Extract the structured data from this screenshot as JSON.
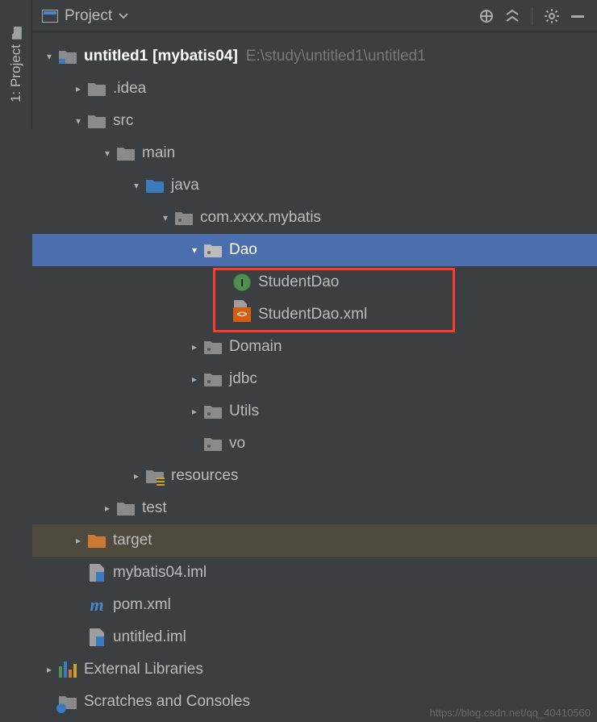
{
  "sidebar_tab": {
    "label": "1: Project"
  },
  "toolbar": {
    "title": "Project"
  },
  "tree": {
    "root": {
      "name": "untitled1",
      "module": "[mybatis04]",
      "path": "E:\\study\\untitled1\\untitled1"
    },
    "idea": ".idea",
    "src": "src",
    "main": "main",
    "java": "java",
    "pkg": "com.xxxx.mybatis",
    "dao": "Dao",
    "student_dao": "StudentDao",
    "student_dao_xml": "StudentDao.xml",
    "domain": "Domain",
    "jdbc": "jdbc",
    "utils": "Utils",
    "vo": "vo",
    "resources": "resources",
    "test": "test",
    "target": "target",
    "iml1": "mybatis04.iml",
    "pom": "pom.xml",
    "iml2": "untitled.iml",
    "ext_lib": "External Libraries",
    "scratches": "Scratches and Consoles"
  },
  "watermark": "https://blog.csdn.net/qq_40410560"
}
